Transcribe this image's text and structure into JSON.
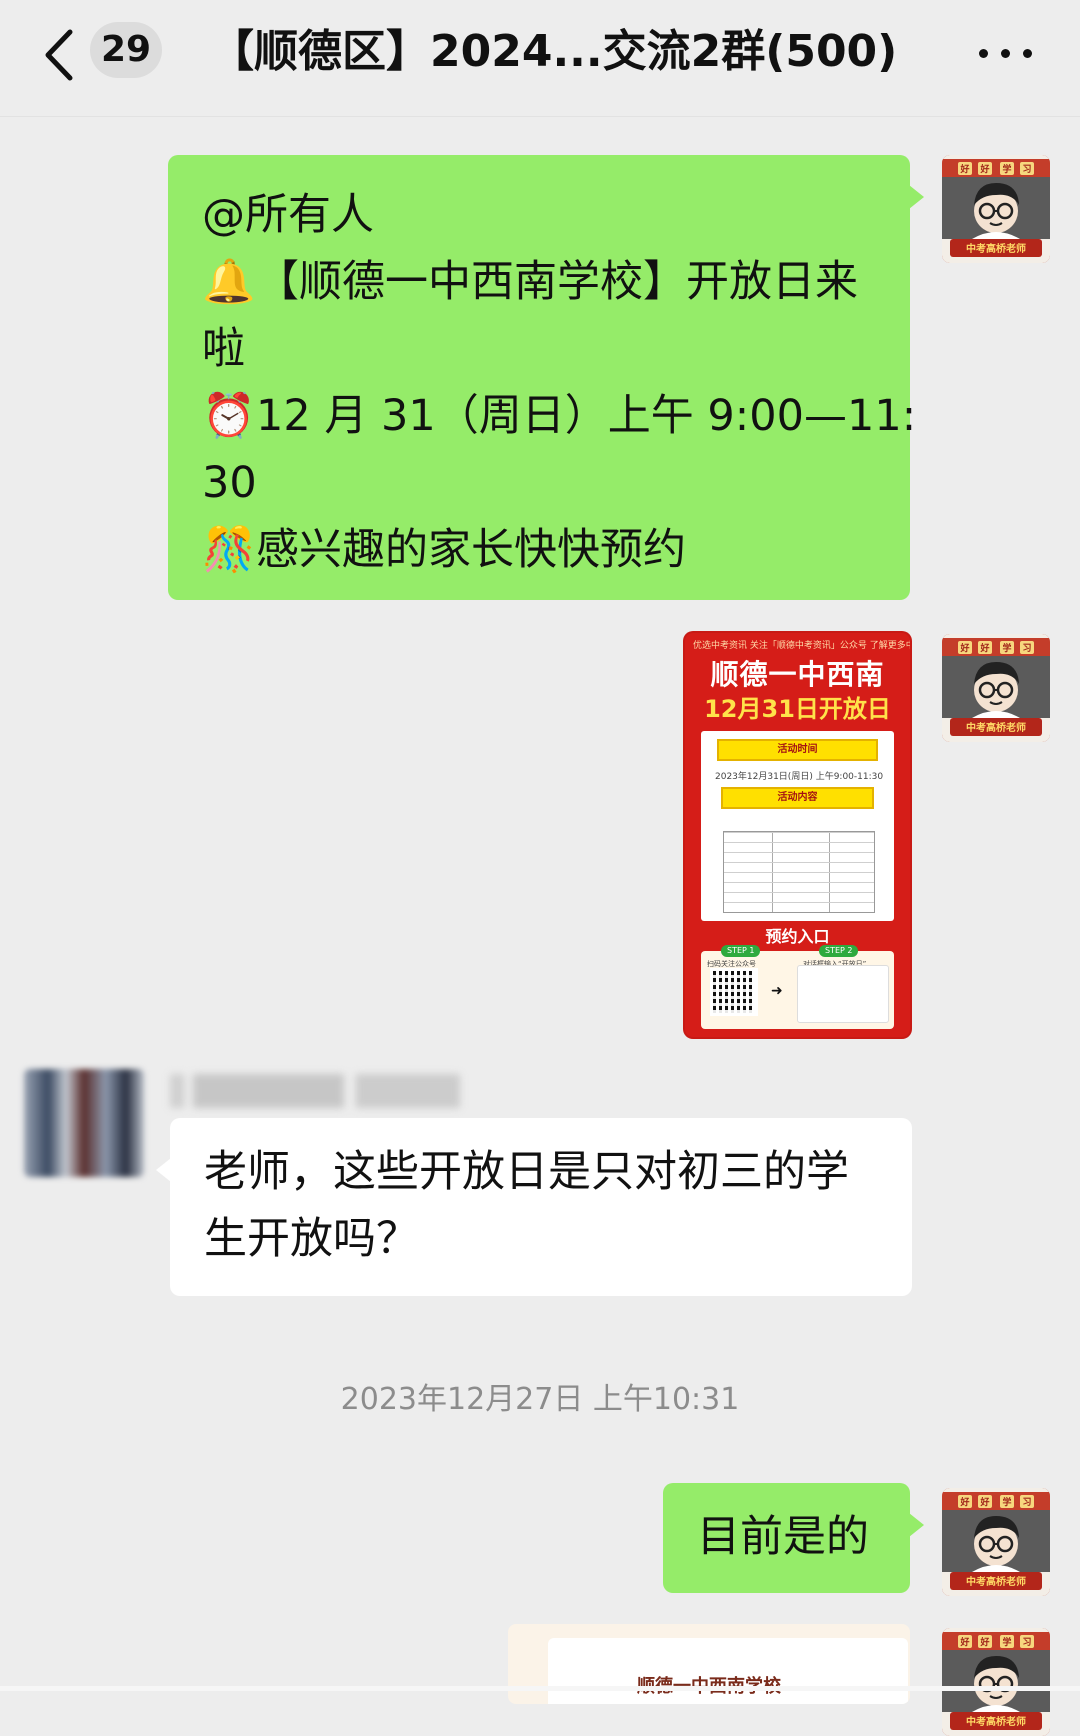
{
  "header": {
    "back_label": "<",
    "unread_count": "29",
    "title": "【顺德区】2024...交流2群(500)",
    "more_label": "..."
  },
  "messages": {
    "announce": {
      "lines": [
        "@所有人",
        "【顺德一中西南学校】开放日来",
        "啦",
        "12 月 31（周日）上午 9:00—11:",
        "30",
        "感兴趣的家长快快预约"
      ],
      "emojis": [
        "🔔",
        "⏰",
        "🎊"
      ]
    },
    "poster": {
      "top_line": "优选中考资讯      关注「顺德中考资讯」公众号   了解更多中考资讯",
      "title1": "顺德一中西南",
      "title2": "12月31日开放日",
      "banner_time": "活动时间",
      "time_text": "2023年12月31日(周日) 上午9:00-11:30",
      "banner_content": "活动内容",
      "reserve": "预约入口",
      "step1": "STEP 1",
      "step2": "STEP 2",
      "step1_text": "扫码关注公众号",
      "step2_text": "对话框输入“开放日”"
    },
    "question": {
      "lines": [
        "老师，这些开放日是只对初三的学",
        "生开放吗？"
      ]
    },
    "timestamp": "2023年12月27日 上午10:31",
    "reply": "目前是的",
    "partial_card_title": "顺德一中西南学校"
  },
  "avatar": {
    "label_top": [
      "好",
      "好",
      "学",
      "习"
    ],
    "label_bottom": "中考高桥老师"
  },
  "colors": {
    "green_bubble": "#95ec69",
    "background": "#ededed",
    "poster_red": "#d51d18"
  }
}
